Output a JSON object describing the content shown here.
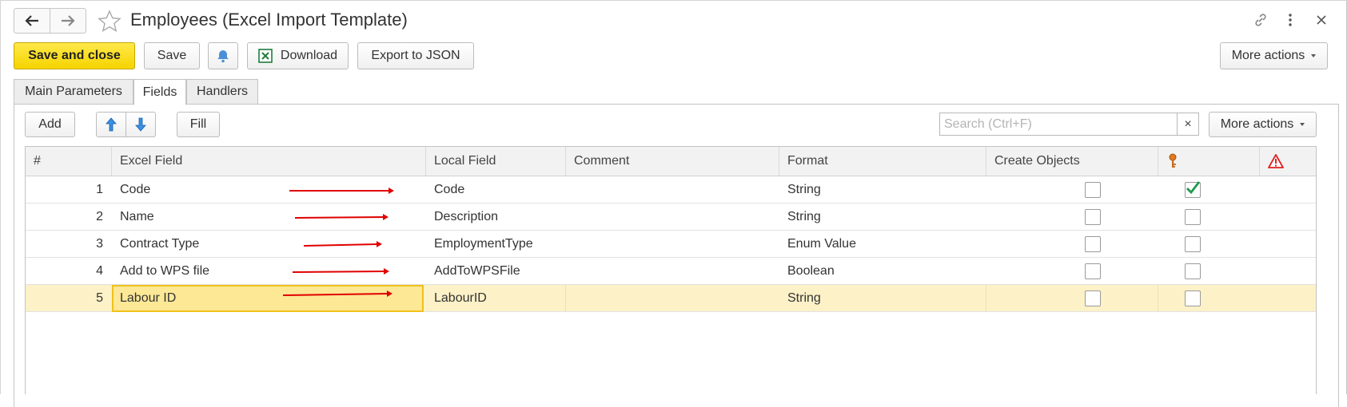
{
  "window": {
    "title": "Employees (Excel Import Template)",
    "icons": {
      "back": "arrow-left-icon",
      "forward": "arrow-right-icon",
      "favorite": "star-icon",
      "link": "link-icon",
      "menu": "vertical-dots-icon",
      "close": "close-icon"
    }
  },
  "toolbar": {
    "save_and_close": "Save and close",
    "save": "Save",
    "bell_icon": "bell-icon",
    "download": "Download",
    "download_icon": "excel-icon",
    "export_json": "Export to JSON",
    "more_actions": "More actions"
  },
  "tabs": [
    {
      "label": "Main Parameters",
      "active": false
    },
    {
      "label": "Fields",
      "active": true
    },
    {
      "label": "Handlers",
      "active": false
    }
  ],
  "fields_toolbar": {
    "add": "Add",
    "move_up_icon": "arrow-up-icon",
    "move_down_icon": "arrow-down-icon",
    "fill": "Fill",
    "search_placeholder": "Search (Ctrl+F)",
    "search_value": "",
    "clear_icon": "clear-icon",
    "clear_label": "×",
    "more_actions": "More actions"
  },
  "grid": {
    "columns": [
      "#",
      "Excel Field",
      "Local Field",
      "Comment",
      "Format",
      "Create Objects"
    ],
    "extra_columns_icons": [
      "key-icon",
      "warning-icon"
    ],
    "rows": [
      {
        "num": "1",
        "excel_field": "Code",
        "local_field": "Code",
        "comment": "",
        "format": "String",
        "create_objects": "",
        "key": false,
        "required": true
      },
      {
        "num": "2",
        "excel_field": "Name",
        "local_field": "Description",
        "comment": "",
        "format": "String",
        "create_objects": "",
        "key": false,
        "required": false
      },
      {
        "num": "3",
        "excel_field": "Contract Type",
        "local_field": "EmploymentType",
        "comment": "",
        "format": "Enum Value",
        "create_objects": "",
        "key": false,
        "required": false
      },
      {
        "num": "4",
        "excel_field": "Add to WPS file",
        "local_field": "AddToWPSFile",
        "comment": "",
        "format": "Boolean",
        "create_objects": "",
        "key": false,
        "required": false
      },
      {
        "num": "5",
        "excel_field": "Labour ID",
        "local_field": "LabourID",
        "comment": "",
        "format": "String",
        "create_objects": "",
        "key": false,
        "required": false
      }
    ],
    "selected_row": 5
  },
  "colors": {
    "accent_yellow": "#f5d400",
    "selection": "#fcf1c7",
    "focus_border": "#f0c11a",
    "annotation_arrow": "#e00000",
    "check": "#1f9a4e"
  }
}
